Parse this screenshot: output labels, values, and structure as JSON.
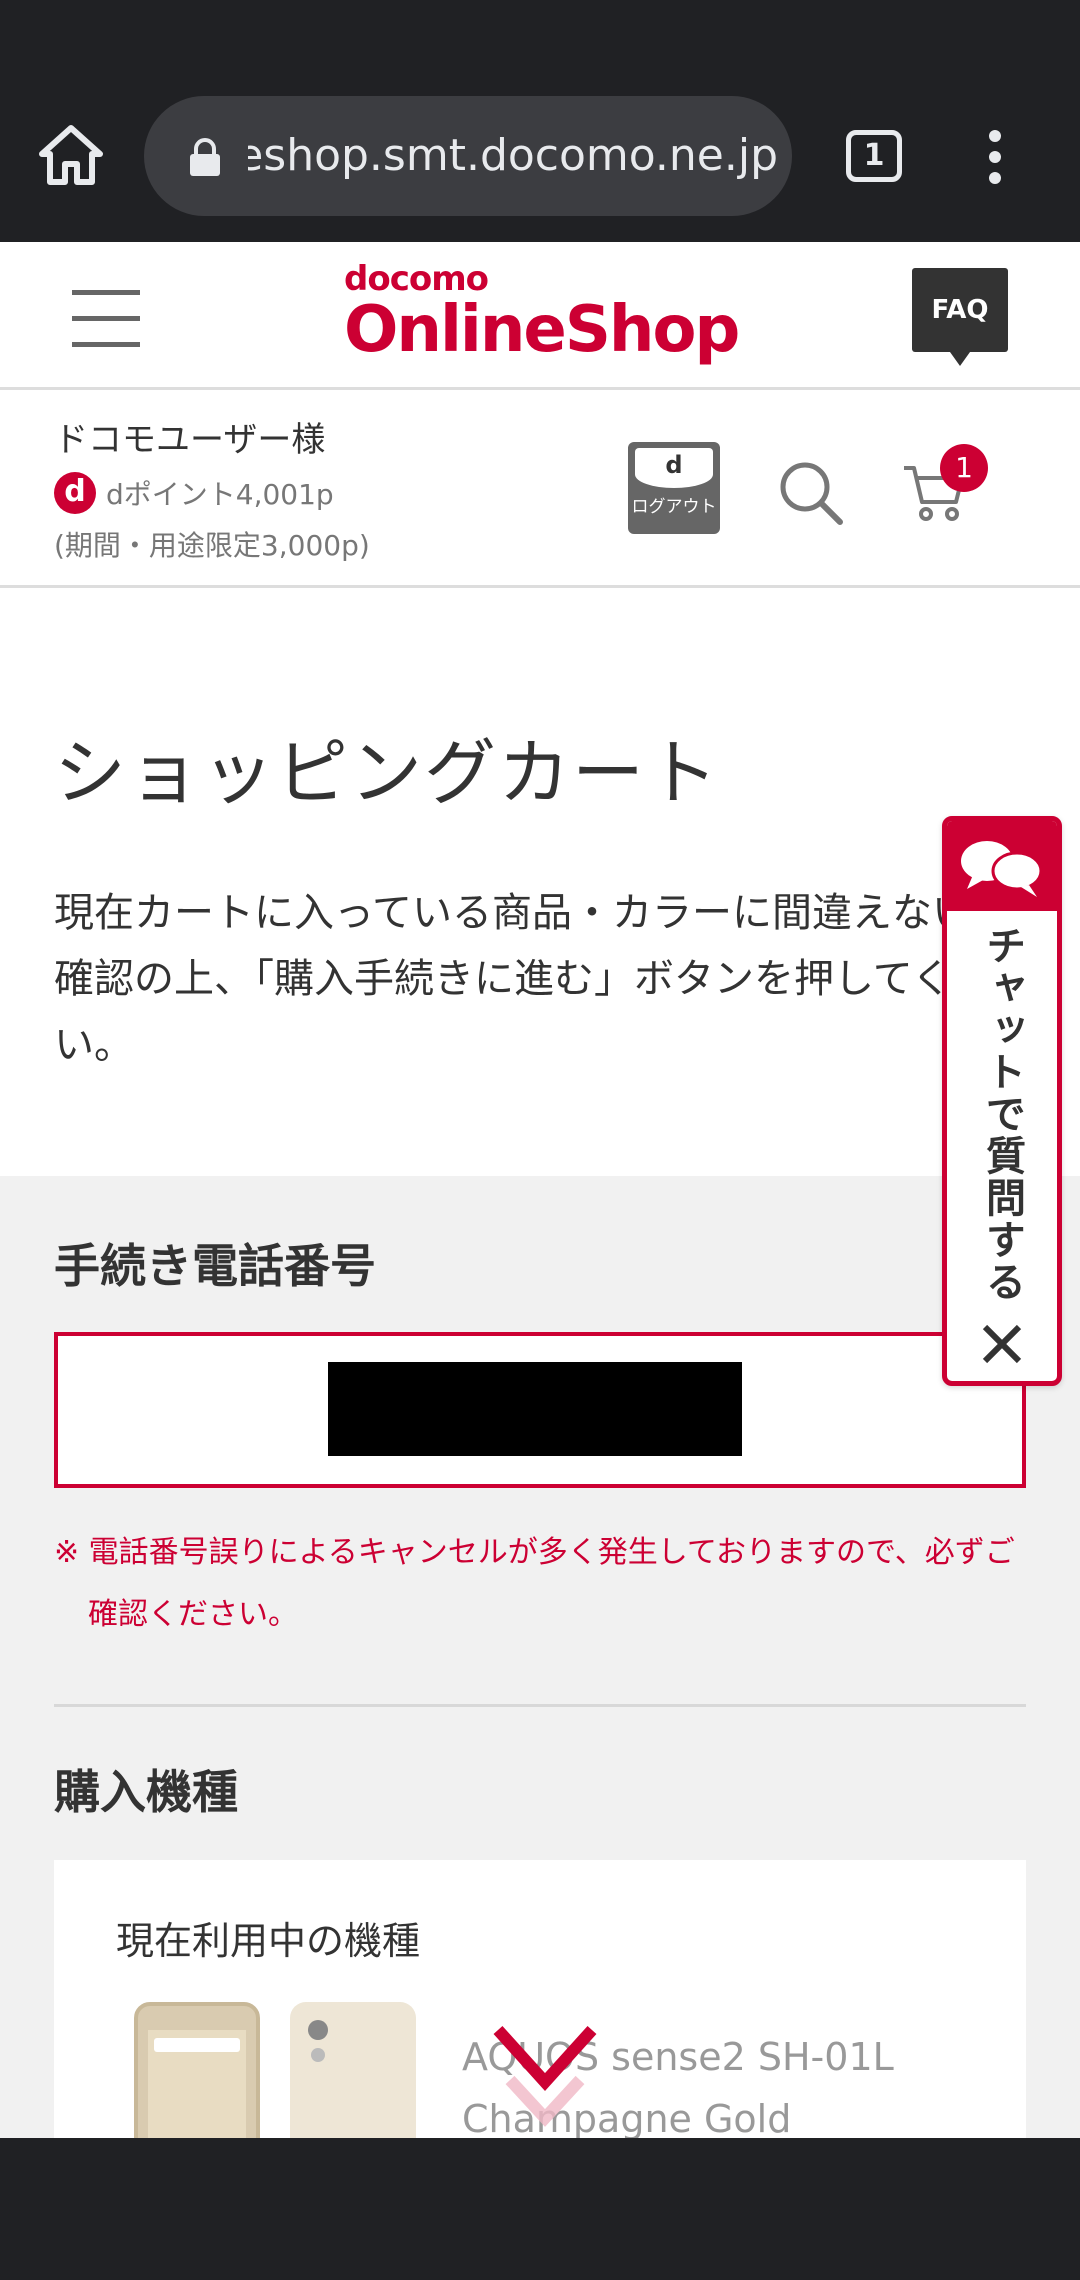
{
  "browser": {
    "url": "eshop.smt.docomo.ne.jp",
    "tab_count": "1"
  },
  "header": {
    "logo_small": "docomo",
    "logo_big": "OnlineShop",
    "faq_label": "FAQ"
  },
  "user": {
    "name": "ドコモユーザー様",
    "d_icon": "d",
    "dpoint": "dポイント4,001p",
    "limited": "(期間・用途限定3,000p)",
    "logout_top": "d",
    "logout_label": "ログアウト",
    "cart_count": "1"
  },
  "main": {
    "title": "ショッピングカート",
    "intro": "現在カートに入っている商品・カラーに間違えないかご確認の上、「購入手続きに進む」ボタンを押してください。",
    "phone_section_title": "手続き電話番号",
    "phone_note": "※ 電話番号誤りによるキャンセルが多く発生しておりますので、必ずご確認ください。",
    "device_section_title": "購入機種",
    "device_card_title": "現在利用中の機種",
    "device_model": "AQUOS sense2 SH-01L",
    "device_color": "Champagne Gold"
  },
  "chat": {
    "label": "チャットで質問する"
  },
  "colors": {
    "accent": "#cc0033",
    "browser_chrome": "#202124"
  },
  "icons": [
    "home-icon",
    "lock-icon",
    "tabs-icon",
    "more-vert-icon",
    "hamburger-icon",
    "faq-icon",
    "search-icon",
    "cart-icon",
    "chat-bubbles-icon",
    "close-icon",
    "chevron-down-icon"
  ]
}
